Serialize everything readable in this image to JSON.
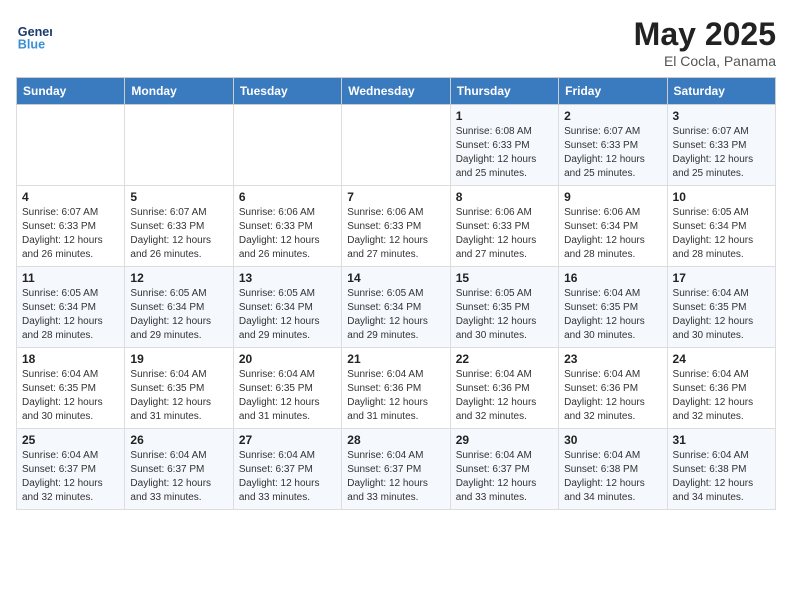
{
  "header": {
    "logo_line1": "General",
    "logo_line2": "Blue",
    "month_year": "May 2025",
    "location": "El Cocla, Panama"
  },
  "weekdays": [
    "Sunday",
    "Monday",
    "Tuesday",
    "Wednesday",
    "Thursday",
    "Friday",
    "Saturday"
  ],
  "weeks": [
    [
      {
        "day": "",
        "info": ""
      },
      {
        "day": "",
        "info": ""
      },
      {
        "day": "",
        "info": ""
      },
      {
        "day": "",
        "info": ""
      },
      {
        "day": "1",
        "info": "Sunrise: 6:08 AM\nSunset: 6:33 PM\nDaylight: 12 hours\nand 25 minutes."
      },
      {
        "day": "2",
        "info": "Sunrise: 6:07 AM\nSunset: 6:33 PM\nDaylight: 12 hours\nand 25 minutes."
      },
      {
        "day": "3",
        "info": "Sunrise: 6:07 AM\nSunset: 6:33 PM\nDaylight: 12 hours\nand 25 minutes."
      }
    ],
    [
      {
        "day": "4",
        "info": "Sunrise: 6:07 AM\nSunset: 6:33 PM\nDaylight: 12 hours\nand 26 minutes."
      },
      {
        "day": "5",
        "info": "Sunrise: 6:07 AM\nSunset: 6:33 PM\nDaylight: 12 hours\nand 26 minutes."
      },
      {
        "day": "6",
        "info": "Sunrise: 6:06 AM\nSunset: 6:33 PM\nDaylight: 12 hours\nand 26 minutes."
      },
      {
        "day": "7",
        "info": "Sunrise: 6:06 AM\nSunset: 6:33 PM\nDaylight: 12 hours\nand 27 minutes."
      },
      {
        "day": "8",
        "info": "Sunrise: 6:06 AM\nSunset: 6:33 PM\nDaylight: 12 hours\nand 27 minutes."
      },
      {
        "day": "9",
        "info": "Sunrise: 6:06 AM\nSunset: 6:34 PM\nDaylight: 12 hours\nand 28 minutes."
      },
      {
        "day": "10",
        "info": "Sunrise: 6:05 AM\nSunset: 6:34 PM\nDaylight: 12 hours\nand 28 minutes."
      }
    ],
    [
      {
        "day": "11",
        "info": "Sunrise: 6:05 AM\nSunset: 6:34 PM\nDaylight: 12 hours\nand 28 minutes."
      },
      {
        "day": "12",
        "info": "Sunrise: 6:05 AM\nSunset: 6:34 PM\nDaylight: 12 hours\nand 29 minutes."
      },
      {
        "day": "13",
        "info": "Sunrise: 6:05 AM\nSunset: 6:34 PM\nDaylight: 12 hours\nand 29 minutes."
      },
      {
        "day": "14",
        "info": "Sunrise: 6:05 AM\nSunset: 6:34 PM\nDaylight: 12 hours\nand 29 minutes."
      },
      {
        "day": "15",
        "info": "Sunrise: 6:05 AM\nSunset: 6:35 PM\nDaylight: 12 hours\nand 30 minutes."
      },
      {
        "day": "16",
        "info": "Sunrise: 6:04 AM\nSunset: 6:35 PM\nDaylight: 12 hours\nand 30 minutes."
      },
      {
        "day": "17",
        "info": "Sunrise: 6:04 AM\nSunset: 6:35 PM\nDaylight: 12 hours\nand 30 minutes."
      }
    ],
    [
      {
        "day": "18",
        "info": "Sunrise: 6:04 AM\nSunset: 6:35 PM\nDaylight: 12 hours\nand 30 minutes."
      },
      {
        "day": "19",
        "info": "Sunrise: 6:04 AM\nSunset: 6:35 PM\nDaylight: 12 hours\nand 31 minutes."
      },
      {
        "day": "20",
        "info": "Sunrise: 6:04 AM\nSunset: 6:35 PM\nDaylight: 12 hours\nand 31 minutes."
      },
      {
        "day": "21",
        "info": "Sunrise: 6:04 AM\nSunset: 6:36 PM\nDaylight: 12 hours\nand 31 minutes."
      },
      {
        "day": "22",
        "info": "Sunrise: 6:04 AM\nSunset: 6:36 PM\nDaylight: 12 hours\nand 32 minutes."
      },
      {
        "day": "23",
        "info": "Sunrise: 6:04 AM\nSunset: 6:36 PM\nDaylight: 12 hours\nand 32 minutes."
      },
      {
        "day": "24",
        "info": "Sunrise: 6:04 AM\nSunset: 6:36 PM\nDaylight: 12 hours\nand 32 minutes."
      }
    ],
    [
      {
        "day": "25",
        "info": "Sunrise: 6:04 AM\nSunset: 6:37 PM\nDaylight: 12 hours\nand 32 minutes."
      },
      {
        "day": "26",
        "info": "Sunrise: 6:04 AM\nSunset: 6:37 PM\nDaylight: 12 hours\nand 33 minutes."
      },
      {
        "day": "27",
        "info": "Sunrise: 6:04 AM\nSunset: 6:37 PM\nDaylight: 12 hours\nand 33 minutes."
      },
      {
        "day": "28",
        "info": "Sunrise: 6:04 AM\nSunset: 6:37 PM\nDaylight: 12 hours\nand 33 minutes."
      },
      {
        "day": "29",
        "info": "Sunrise: 6:04 AM\nSunset: 6:37 PM\nDaylight: 12 hours\nand 33 minutes."
      },
      {
        "day": "30",
        "info": "Sunrise: 6:04 AM\nSunset: 6:38 PM\nDaylight: 12 hours\nand 34 minutes."
      },
      {
        "day": "31",
        "info": "Sunrise: 6:04 AM\nSunset: 6:38 PM\nDaylight: 12 hours\nand 34 minutes."
      }
    ]
  ]
}
